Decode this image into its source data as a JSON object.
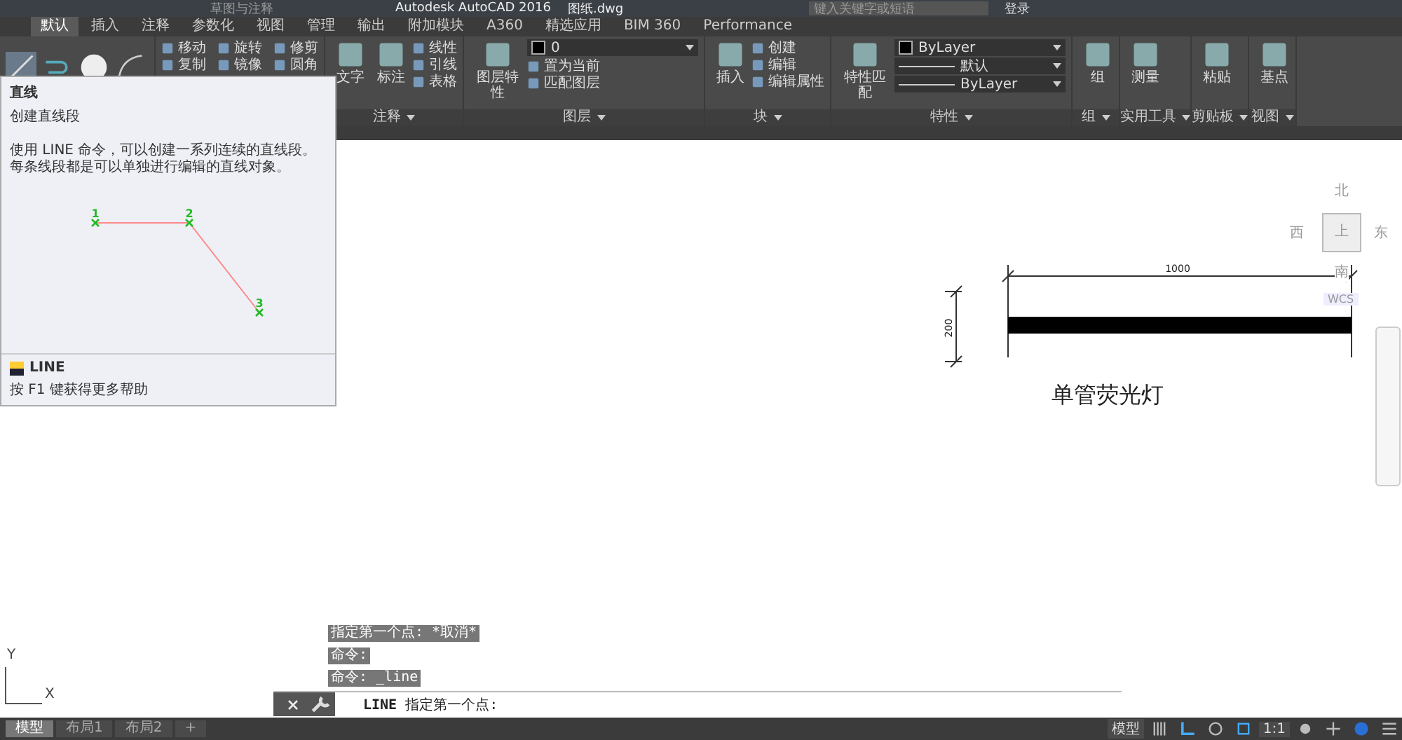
{
  "title_bar": {
    "workspace": "草图与注释",
    "title": "Autodesk AutoCAD 2016",
    "file": "图纸.dwg",
    "search_placeholder": "键入关键字或短语",
    "user": "登录"
  },
  "tabs": [
    {
      "label": "默认",
      "selected": true
    },
    {
      "label": "插入",
      "selected": false
    },
    {
      "label": "注释",
      "selected": false
    },
    {
      "label": "参数化",
      "selected": false
    },
    {
      "label": "视图",
      "selected": false
    },
    {
      "label": "管理",
      "selected": false
    },
    {
      "label": "输出",
      "selected": false
    },
    {
      "label": "附加模块",
      "selected": false
    },
    {
      "label": "A360",
      "selected": false
    },
    {
      "label": "精选应用",
      "selected": false
    },
    {
      "label": "BIM 360",
      "selected": false
    },
    {
      "label": "Performance",
      "selected": false
    }
  ],
  "panels": [
    {
      "kind": "draw"
    },
    {
      "kind": "tools",
      "small": [
        "移动",
        "旋转",
        "修剪",
        "复制",
        "镜像",
        "圆角"
      ]
    },
    {
      "kind": "tools",
      "label": "注释",
      "big": [
        "文字",
        "标注"
      ],
      "small": [
        "线性",
        "引线",
        "表格"
      ]
    },
    {
      "kind": "tools",
      "label": "图层",
      "big": [
        "图层特性"
      ],
      "fields": [
        {
          "kind": "layer",
          "value": "0"
        }
      ],
      "small": [
        "置为当前",
        "匹配图层"
      ]
    },
    {
      "kind": "tools",
      "label": "块",
      "big": [
        "插入"
      ],
      "small": [
        "创建",
        "编辑",
        "编辑属性"
      ]
    },
    {
      "kind": "tools",
      "label": "特性",
      "big": [
        "特性匹配"
      ],
      "fields": [
        {
          "kind": "color",
          "value": "ByLayer"
        },
        {
          "kind": "linetype",
          "value": "默认"
        },
        {
          "kind": "linetype",
          "value": "ByLayer"
        }
      ]
    },
    {
      "kind": "tools",
      "label": "组",
      "big": [
        "组"
      ]
    },
    {
      "kind": "tools",
      "label": "实用工具",
      "big": [
        "测量"
      ]
    },
    {
      "kind": "tools",
      "label": "剪贴板",
      "big": [
        "粘贴"
      ]
    },
    {
      "kind": "tools",
      "label": "视图",
      "big": [
        "基点"
      ]
    }
  ],
  "tooltip": {
    "title": "直线",
    "subtitle": "创建直线段",
    "description": "使用 LINE 命令，可以创建一系列连续的直线段。每条线段都是可以单独进行编辑的直线对象。",
    "points": [
      "1",
      "2",
      "3"
    ],
    "command": "LINE",
    "help": "按 F1 键获得更多帮助"
  },
  "drawing": {
    "width_dimension": "1000",
    "height_dimension": "200",
    "caption": "单管荧光灯"
  },
  "viewcube": {
    "north": "北",
    "west": "西",
    "east": "东",
    "south": "南",
    "face": "上",
    "ucs": "WCS"
  },
  "ucs_icon": {
    "x": "X",
    "y": "Y"
  },
  "command_history": [
    "指定第一个点: *取消*",
    "命令:",
    "命令: _line"
  ],
  "command_line": {
    "command": "LINE",
    "prompt": "指定第一个点:"
  },
  "layout_tabs": [
    {
      "label": "模型",
      "selected": true
    },
    {
      "label": "布局1",
      "selected": false
    },
    {
      "label": "布局2",
      "selected": false
    }
  ],
  "add_tab": "+",
  "status_bar": {
    "space": "模型",
    "scale": "1:1"
  }
}
